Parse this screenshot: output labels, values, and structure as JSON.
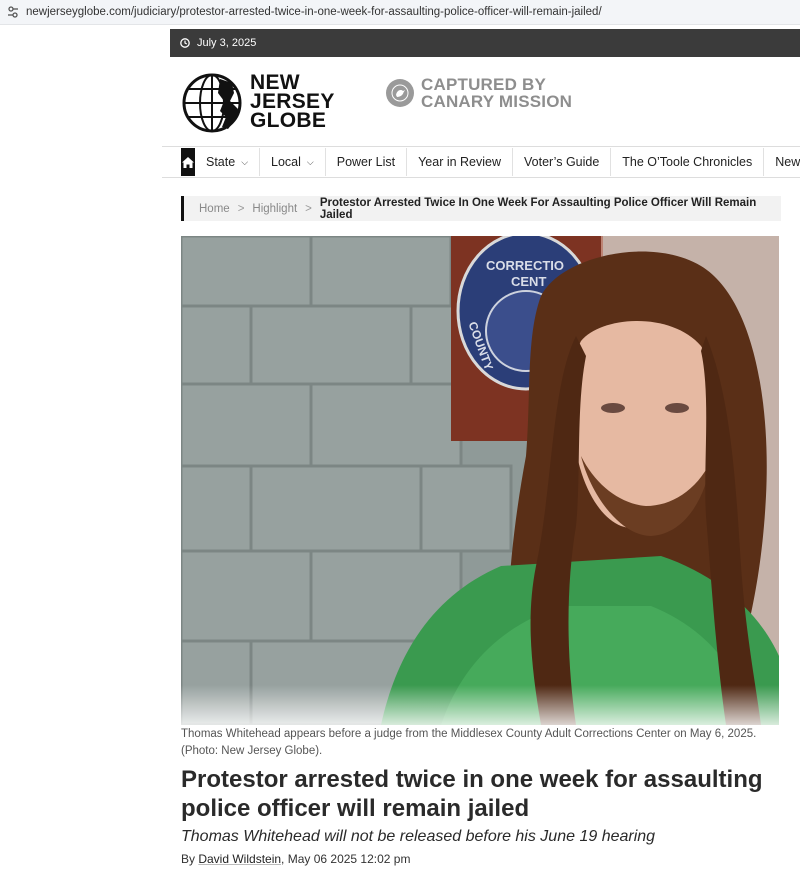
{
  "browser": {
    "url": "newjerseyglobe.com/judiciary/protestor-arrested-twice-in-one-week-for-assaulting-police-officer-will-remain-jailed/",
    "icon": "site-settings-icon"
  },
  "topbar": {
    "date": "July 3, 2025",
    "icon": "clock-icon"
  },
  "logo": {
    "line1": "NEW",
    "line2": "JERSEY",
    "line3": "GLOBE"
  },
  "sponsor": {
    "line1": "CAPTURED BY",
    "line2": "CANARY MISSION"
  },
  "nav": {
    "items": [
      {
        "label": "State",
        "has_dropdown": true
      },
      {
        "label": "Local",
        "has_dropdown": true
      },
      {
        "label": "Power List",
        "has_dropdown": false
      },
      {
        "label": "Year in Review",
        "has_dropdown": false
      },
      {
        "label": "Voter’s Guide",
        "has_dropdown": false
      },
      {
        "label": "The O’Toole Chronicles",
        "has_dropdown": false
      },
      {
        "label": "New Jers",
        "has_dropdown": false
      }
    ]
  },
  "breadcrumb": {
    "home": "Home",
    "section": "Highlight",
    "separator": ">",
    "current": "Protestor Arrested Twice In One Week For Assaulting Police Officer Will Remain Jailed"
  },
  "hero": {
    "caption": "Thomas Whitehead appears before a judge from the Middlesex County Adult Corrections Center on May 6, 2025. (Photo: New Jersey Globe).",
    "plaque_text_top": "CORRECTIO",
    "plaque_text_mid": "CENT",
    "plaque_text_side": "COUNTY"
  },
  "article": {
    "headline": "Protestor arrested twice in one week for assaulting police officer will remain jailed",
    "subhead": "Thomas Whitehead will not be released before his June 19 hearing",
    "by_label": "By ",
    "author": "David Wildstein",
    "date": ", May 06 2025 12:02 pm"
  },
  "colors": {
    "topbar": "#3b3b3b",
    "nav_home": "#111111",
    "sponsor_gray": "#8e8e8e"
  }
}
